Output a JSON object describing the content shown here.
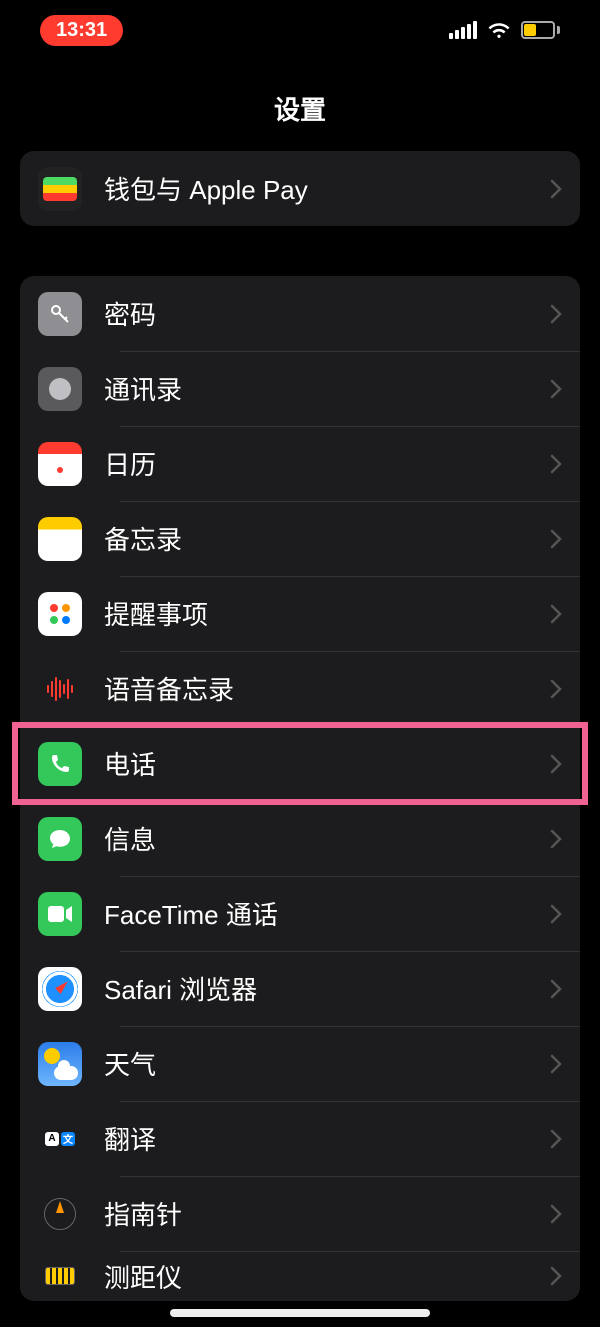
{
  "status": {
    "time": "13:31"
  },
  "header": {
    "title": "设置"
  },
  "group1": {
    "wallet": "钱包与 Apple Pay"
  },
  "group2": {
    "passwords": "密码",
    "contacts": "通讯录",
    "calendar": "日历",
    "notes": "备忘录",
    "reminders": "提醒事项",
    "voice_memos": "语音备忘录",
    "phone": "电话",
    "messages": "信息",
    "facetime": "FaceTime 通话",
    "safari": "Safari 浏览器",
    "weather": "天气",
    "translate": "翻译",
    "compass": "指南针",
    "measure": "测距仪"
  },
  "highlighted_row": "phone"
}
